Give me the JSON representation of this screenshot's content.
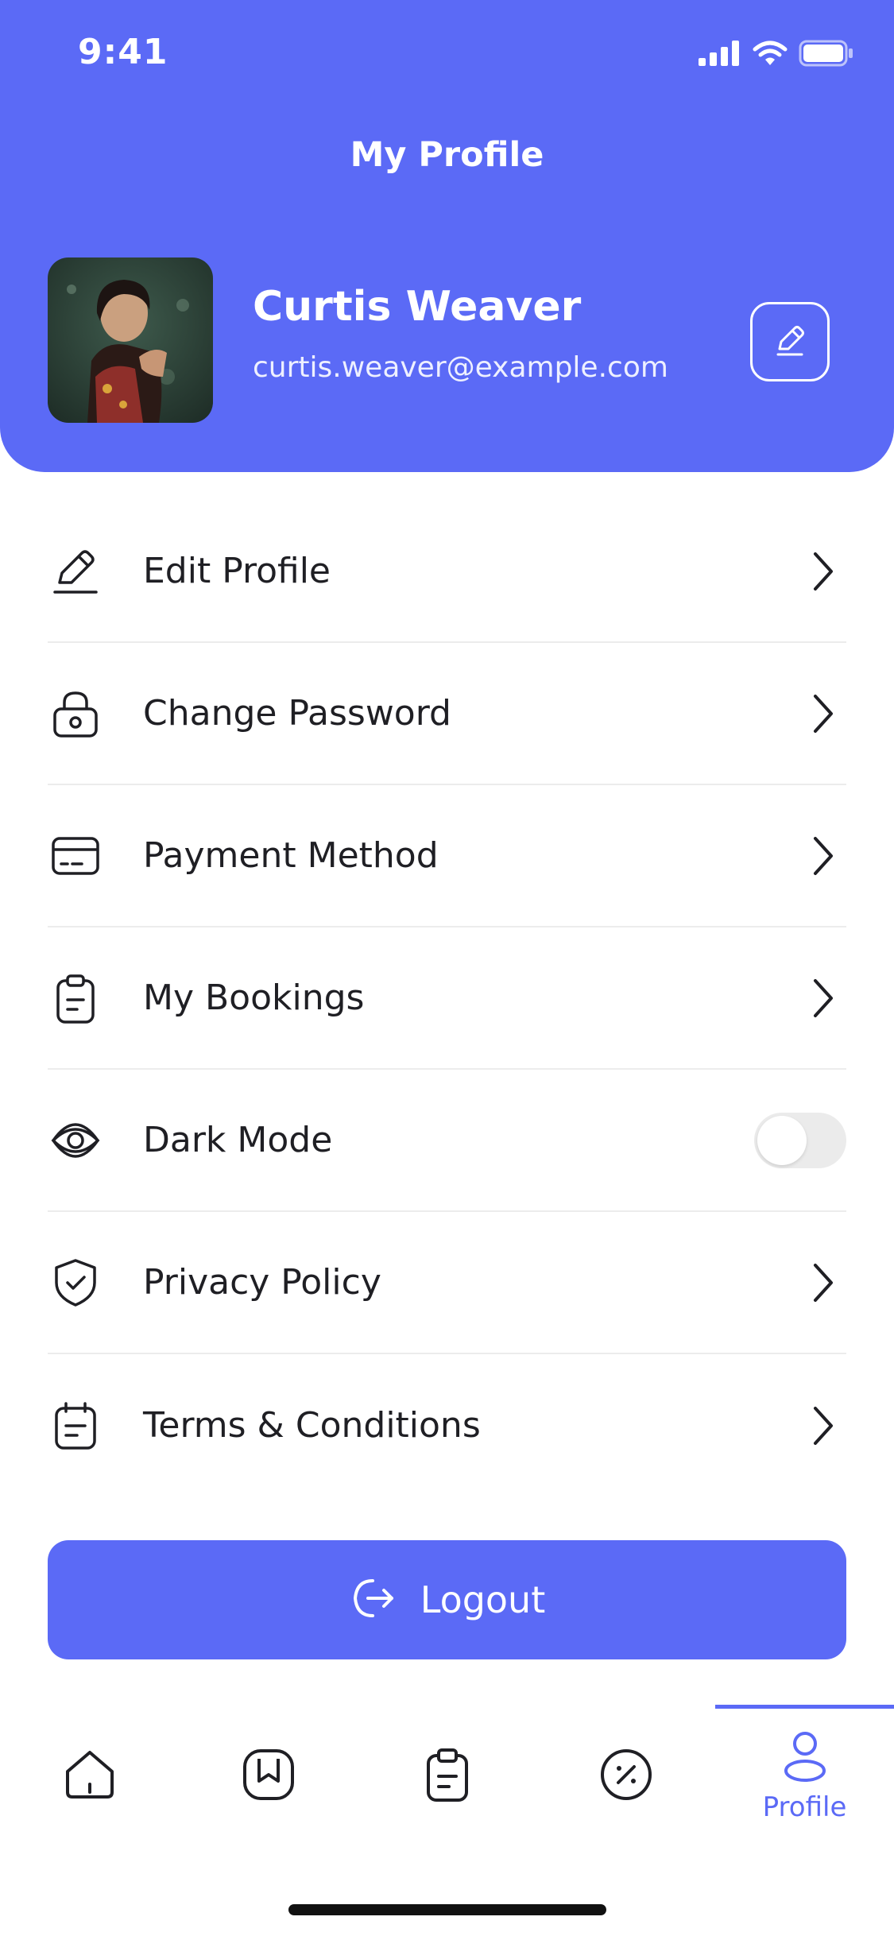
{
  "status_bar": {
    "time": "9:41",
    "icons": [
      "signal-icon",
      "wifi-icon",
      "battery-icon"
    ]
  },
  "header": {
    "title": "My Profile"
  },
  "profile": {
    "name": "Curtis Weaver",
    "email": "curtis.weaver@example.com",
    "avatar": "profile-photo",
    "edit_icon": "pencil-icon"
  },
  "menu": {
    "items": [
      {
        "label": "Edit Profile",
        "icon": "pencil-icon",
        "control": "chevron"
      },
      {
        "label": "Change Password",
        "icon": "lock-icon",
        "control": "chevron"
      },
      {
        "label": "Payment Method",
        "icon": "card-icon",
        "control": "chevron"
      },
      {
        "label": "My Bookings",
        "icon": "clipboard-icon",
        "control": "chevron"
      },
      {
        "label": "Dark Mode",
        "icon": "eye-icon",
        "control": "toggle",
        "enabled": false
      },
      {
        "label": "Privacy Policy",
        "icon": "shield-check-icon",
        "control": "chevron"
      },
      {
        "label": "Terms & Conditions",
        "icon": "calendar-doc-icon",
        "control": "chevron"
      }
    ]
  },
  "logout": {
    "label": "Logout",
    "icon": "logout-icon"
  },
  "tabbar": {
    "tabs": [
      {
        "icon": "home-icon",
        "label": "",
        "active": false
      },
      {
        "icon": "bookmark-icon",
        "label": "",
        "active": false
      },
      {
        "icon": "clipboard-icon",
        "label": "",
        "active": false
      },
      {
        "icon": "discount-icon",
        "label": "",
        "active": false
      },
      {
        "icon": "user-icon",
        "label": "Profile",
        "active": true
      }
    ]
  },
  "colors": {
    "accent": "#5b6af6",
    "text": "#1f1f24",
    "divider": "#ececec",
    "toggle_off": "#ebebeb"
  }
}
